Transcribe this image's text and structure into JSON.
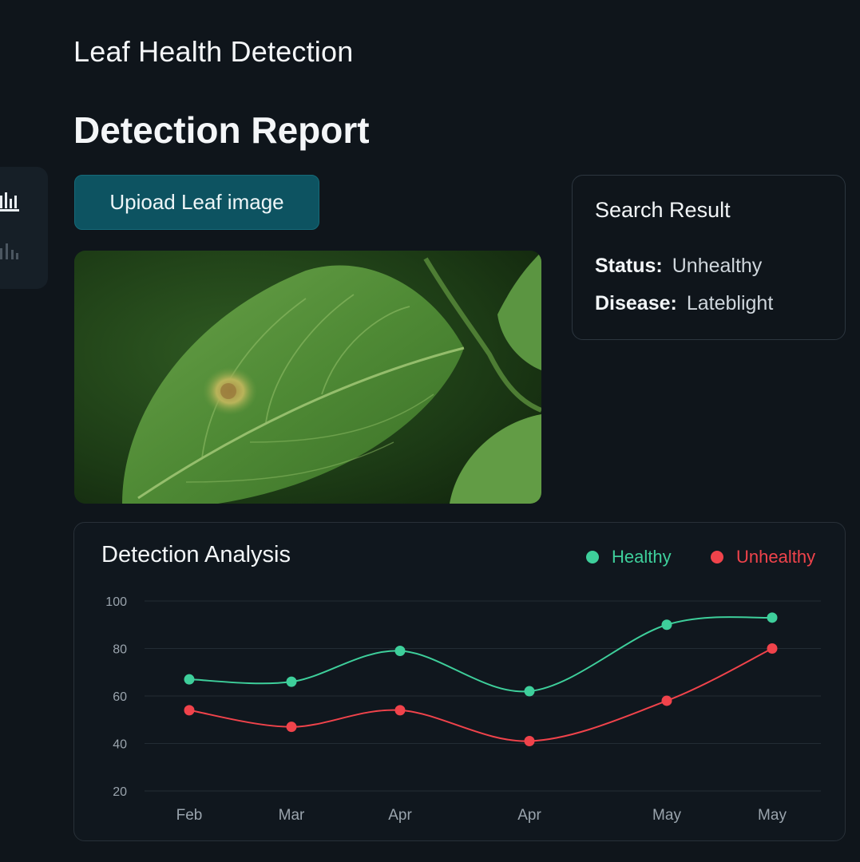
{
  "header": {
    "app_title": "Leaf Health Detection",
    "page_title": "Detection Report"
  },
  "sidebar": {
    "items": [
      {
        "icon": "bar-chart-icon",
        "active": true
      },
      {
        "icon": "analytics-icon",
        "active": false
      }
    ]
  },
  "upload": {
    "label": "Upioad Leaf image"
  },
  "leaf_image": {
    "subject": "green leaf with yellow-brown lesion"
  },
  "search_result": {
    "title": "Search Result",
    "status_label": "Status:",
    "status_value": "Unhealthy",
    "disease_label": "Disease:",
    "disease_value": "Lateblight"
  },
  "colors": {
    "background": "#0f151b",
    "accent_button": "#0d5361",
    "healthy": "#3ecf9b",
    "unhealthy": "#f0434b"
  },
  "chart_data": {
    "type": "line",
    "title": "Detection Analysis",
    "categories": [
      "Feb",
      "Mar",
      "Apr",
      "Apr",
      "May",
      "May"
    ],
    "series": [
      {
        "name": "Healthy",
        "color": "#3ecf9b",
        "values": [
          67,
          66,
          79,
          62,
          90,
          93
        ]
      },
      {
        "name": "Unhealthy",
        "color": "#f0434b",
        "values": [
          54,
          47,
          54,
          41,
          58,
          80
        ]
      }
    ],
    "y_ticks": [
      100,
      80,
      60,
      40,
      20
    ],
    "ylim": [
      20,
      100
    ],
    "grid": true,
    "legend_position": "top-right"
  }
}
